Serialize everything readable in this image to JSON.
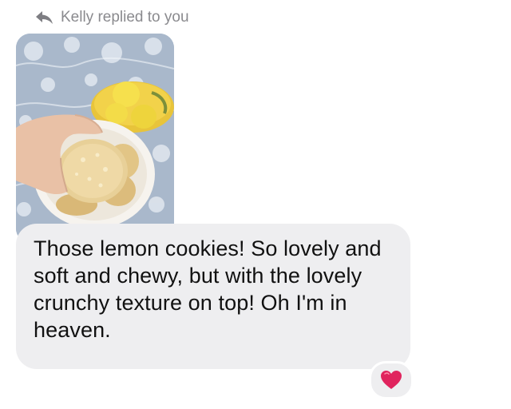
{
  "reply_header": {
    "text": "Kelly replied to you",
    "icon": "reply-arrow-icon"
  },
  "attachment": {
    "kind": "photo",
    "icon": "photo-lemon-cookies"
  },
  "message": {
    "text": "Those lemon cookies! So lovely and soft and chewy, but with the lovely crunchy texture on top! Oh I'm in heaven."
  },
  "reaction": {
    "icon": "heart-icon",
    "color": "#e0245e"
  },
  "colors": {
    "bubble": "#eeeef0",
    "meta_text": "#8a8a8e",
    "message_text": "#111111"
  }
}
